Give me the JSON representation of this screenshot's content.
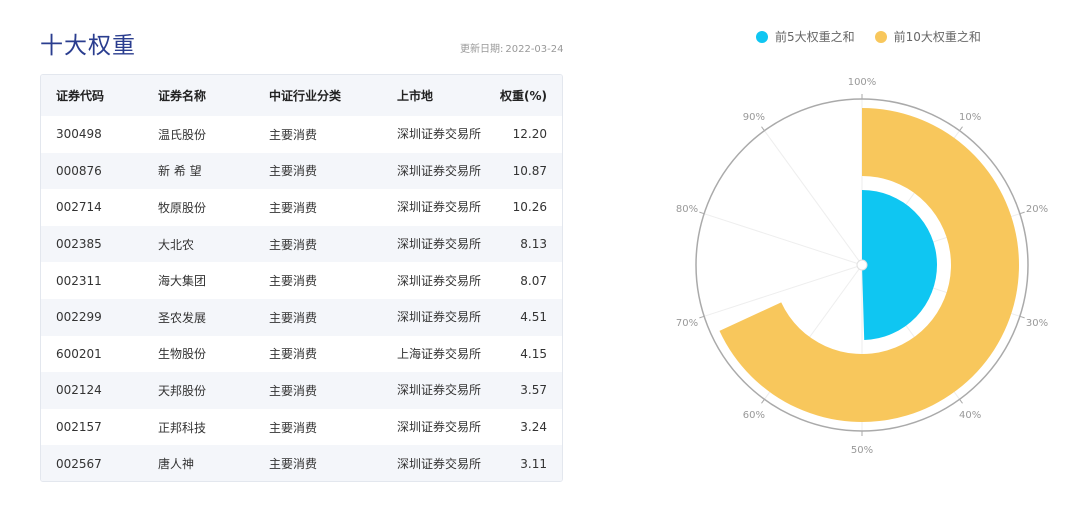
{
  "title": "十大权重",
  "update": {
    "label": "更新日期:",
    "date": "2022-03-24"
  },
  "table": {
    "headers": [
      "证券代码",
      "证券名称",
      "中证行业分类",
      "上市地",
      "权重(%)"
    ],
    "rows": [
      [
        "300498",
        "温氏股份",
        "主要消费",
        "深圳证券交易所",
        "12.20"
      ],
      [
        "000876",
        "新 希 望",
        "主要消费",
        "深圳证券交易所",
        "10.87"
      ],
      [
        "002714",
        "牧原股份",
        "主要消费",
        "深圳证券交易所",
        "10.26"
      ],
      [
        "002385",
        "大北农",
        "主要消费",
        "深圳证券交易所",
        "8.13"
      ],
      [
        "002311",
        "海大集团",
        "主要消费",
        "深圳证券交易所",
        "8.07"
      ],
      [
        "002299",
        "圣农发展",
        "主要消费",
        "深圳证券交易所",
        "4.51"
      ],
      [
        "600201",
        "生物股份",
        "主要消费",
        "上海证券交易所",
        "4.15"
      ],
      [
        "002124",
        "天邦股份",
        "主要消费",
        "深圳证券交易所",
        "3.57"
      ],
      [
        "002157",
        "正邦科技",
        "主要消费",
        "深圳证券交易所",
        "3.24"
      ],
      [
        "002567",
        "唐人神",
        "主要消费",
        "深圳证券交易所",
        "3.11"
      ]
    ]
  },
  "chart_data": {
    "type": "polar-bar",
    "series": [
      {
        "name": "前5大权重之和",
        "value": 49.53,
        "color": "#0fc6f2"
      },
      {
        "name": "前10大权重之和",
        "value": 68.11,
        "color": "#f8c75c"
      }
    ],
    "angle_axis": {
      "min": 0,
      "max": 100,
      "tick_labels": [
        "100%",
        "10%",
        "20%",
        "30%",
        "40%",
        "50%",
        "60%",
        "70%",
        "80%",
        "90%"
      ]
    },
    "legend_position": "top"
  }
}
